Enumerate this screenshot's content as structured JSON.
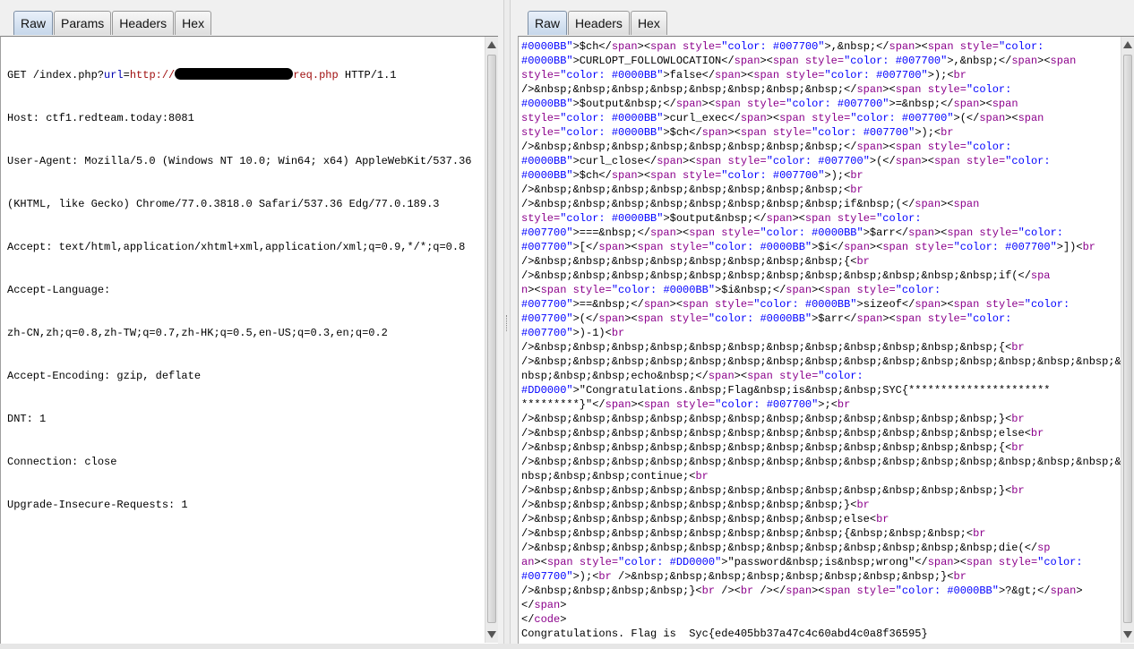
{
  "request_panel": {
    "tabs": [
      "Raw",
      "Params",
      "Headers",
      "Hex"
    ],
    "active_tab": "Raw",
    "request_line": {
      "method_path": "GET /index.php?",
      "param": "url",
      "eq": "=",
      "scheme": "http://",
      "host_suffix": "req.php",
      "version": " HTTP/1.1"
    },
    "headers": [
      "Host: ctf1.redteam.today:8081",
      "User-Agent: Mozilla/5.0 (Windows NT 10.0; Win64; x64) AppleWebKit/537.36",
      "(KHTML, like Gecko) Chrome/77.0.3818.0 Safari/537.36 Edg/77.0.189.3",
      "Accept: text/html,application/xhtml+xml,application/xml;q=0.9,*/*;q=0.8",
      "Accept-Language:",
      "zh-CN,zh;q=0.8,zh-TW;q=0.7,zh-HK;q=0.5,en-US;q=0.3,en;q=0.2",
      "Accept-Encoding: gzip, deflate",
      "DNT: 1",
      "Connection: close",
      "Upgrade-Insecure-Requests: 1"
    ]
  },
  "response_panel": {
    "tabs": [
      "Raw",
      "Headers",
      "Hex"
    ],
    "active_tab": "Raw",
    "colors": {
      "tag": "#8b008b",
      "string": "#0000ff",
      "plain": "#000000",
      "attr": "#8b008b"
    },
    "body_lines": [
      [
        [
          "s",
          "#0000BB\""
        ],
        [
          "p",
          ">$ch</"
        ],
        [
          "t",
          "span"
        ],
        [
          "p",
          "><"
        ],
        [
          "t",
          "span"
        ],
        [
          "a",
          " style="
        ],
        [
          "s",
          "\"color: #007700\""
        ],
        [
          "p",
          ">,&nbsp;</"
        ],
        [
          "t",
          "span"
        ],
        [
          "p",
          "><"
        ],
        [
          "t",
          "span"
        ],
        [
          "a",
          " style="
        ],
        [
          "s",
          "\"color:"
        ]
      ],
      [
        [
          "s",
          "#0000BB\""
        ],
        [
          "p",
          ">CURLOPT_FOLLOWLOCATION</"
        ],
        [
          "t",
          "span"
        ],
        [
          "p",
          "><"
        ],
        [
          "t",
          "span"
        ],
        [
          "a",
          " style="
        ],
        [
          "s",
          "\"color: #007700\""
        ],
        [
          "p",
          ">,&nbsp;</"
        ],
        [
          "t",
          "span"
        ],
        [
          "p",
          "><"
        ],
        [
          "t",
          "span"
        ]
      ],
      [
        [
          "a",
          "style="
        ],
        [
          "s",
          "\"color: #0000BB\""
        ],
        [
          "p",
          ">false</"
        ],
        [
          "t",
          "span"
        ],
        [
          "p",
          "><"
        ],
        [
          "t",
          "span"
        ],
        [
          "a",
          " style="
        ],
        [
          "s",
          "\"color: #007700\""
        ],
        [
          "p",
          ">);<"
        ],
        [
          "t",
          "br"
        ]
      ],
      [
        [
          "p",
          "/>&nbsp;&nbsp;&nbsp;&nbsp;&nbsp;&nbsp;&nbsp;&nbsp;</"
        ],
        [
          "t",
          "span"
        ],
        [
          "p",
          "><"
        ],
        [
          "t",
          "span"
        ],
        [
          "a",
          " style="
        ],
        [
          "s",
          "\"color:"
        ]
      ],
      [
        [
          "s",
          "#0000BB\""
        ],
        [
          "p",
          ">$output&nbsp;</"
        ],
        [
          "t",
          "span"
        ],
        [
          "p",
          "><"
        ],
        [
          "t",
          "span"
        ],
        [
          "a",
          " style="
        ],
        [
          "s",
          "\"color: #007700\""
        ],
        [
          "p",
          ">=&nbsp;</"
        ],
        [
          "t",
          "span"
        ],
        [
          "p",
          "><"
        ],
        [
          "t",
          "span"
        ]
      ],
      [
        [
          "a",
          "style="
        ],
        [
          "s",
          "\"color: #0000BB\""
        ],
        [
          "p",
          ">curl_exec</"
        ],
        [
          "t",
          "span"
        ],
        [
          "p",
          "><"
        ],
        [
          "t",
          "span"
        ],
        [
          "a",
          " style="
        ],
        [
          "s",
          "\"color: #007700\""
        ],
        [
          "p",
          ">(</"
        ],
        [
          "t",
          "span"
        ],
        [
          "p",
          "><"
        ],
        [
          "t",
          "span"
        ]
      ],
      [
        [
          "a",
          "style="
        ],
        [
          "s",
          "\"color: #0000BB\""
        ],
        [
          "p",
          ">$ch</"
        ],
        [
          "t",
          "span"
        ],
        [
          "p",
          "><"
        ],
        [
          "t",
          "span"
        ],
        [
          "a",
          " style="
        ],
        [
          "s",
          "\"color: #007700\""
        ],
        [
          "p",
          ">);<"
        ],
        [
          "t",
          "br"
        ]
      ],
      [
        [
          "p",
          "/>&nbsp;&nbsp;&nbsp;&nbsp;&nbsp;&nbsp;&nbsp;&nbsp;</"
        ],
        [
          "t",
          "span"
        ],
        [
          "p",
          "><"
        ],
        [
          "t",
          "span"
        ],
        [
          "a",
          " style="
        ],
        [
          "s",
          "\"color:"
        ]
      ],
      [
        [
          "s",
          "#0000BB\""
        ],
        [
          "p",
          ">curl_close</"
        ],
        [
          "t",
          "span"
        ],
        [
          "p",
          "><"
        ],
        [
          "t",
          "span"
        ],
        [
          "a",
          " style="
        ],
        [
          "s",
          "\"color: #007700\""
        ],
        [
          "p",
          ">(</"
        ],
        [
          "t",
          "span"
        ],
        [
          "p",
          "><"
        ],
        [
          "t",
          "span"
        ],
        [
          "a",
          " style="
        ],
        [
          "s",
          "\"color:"
        ]
      ],
      [
        [
          "s",
          "#0000BB\""
        ],
        [
          "p",
          ">$ch</"
        ],
        [
          "t",
          "span"
        ],
        [
          "p",
          "><"
        ],
        [
          "t",
          "span"
        ],
        [
          "a",
          " style="
        ],
        [
          "s",
          "\"color: #007700\""
        ],
        [
          "p",
          ">);<"
        ],
        [
          "t",
          "br"
        ]
      ],
      [
        [
          "p",
          "/>&nbsp;&nbsp;&nbsp;&nbsp;&nbsp;&nbsp;&nbsp;&nbsp;<"
        ],
        [
          "t",
          "br"
        ]
      ],
      [
        [
          "p",
          "/>&nbsp;&nbsp;&nbsp;&nbsp;&nbsp;&nbsp;&nbsp;&nbsp;if&nbsp;(</"
        ],
        [
          "t",
          "span"
        ],
        [
          "p",
          "><"
        ],
        [
          "t",
          "span"
        ]
      ],
      [
        [
          "a",
          "style="
        ],
        [
          "s",
          "\"color: #0000BB\""
        ],
        [
          "p",
          ">$output&nbsp;</"
        ],
        [
          "t",
          "span"
        ],
        [
          "p",
          "><"
        ],
        [
          "t",
          "span"
        ],
        [
          "a",
          " style="
        ],
        [
          "s",
          "\"color:"
        ]
      ],
      [
        [
          "s",
          "#007700\""
        ],
        [
          "p",
          ">===&nbsp;</"
        ],
        [
          "t",
          "span"
        ],
        [
          "p",
          "><"
        ],
        [
          "t",
          "span"
        ],
        [
          "a",
          " style="
        ],
        [
          "s",
          "\"color: #0000BB\""
        ],
        [
          "p",
          ">$arr</"
        ],
        [
          "t",
          "span"
        ],
        [
          "p",
          "><"
        ],
        [
          "t",
          "span"
        ],
        [
          "a",
          " style="
        ],
        [
          "s",
          "\"color:"
        ]
      ],
      [
        [
          "s",
          "#007700\""
        ],
        [
          "p",
          ">[</"
        ],
        [
          "t",
          "span"
        ],
        [
          "p",
          "><"
        ],
        [
          "t",
          "span"
        ],
        [
          "a",
          " style="
        ],
        [
          "s",
          "\"color: #0000BB\""
        ],
        [
          "p",
          ">$i</"
        ],
        [
          "t",
          "span"
        ],
        [
          "p",
          "><"
        ],
        [
          "t",
          "span"
        ],
        [
          "a",
          " style="
        ],
        [
          "s",
          "\"color: #007700\""
        ],
        [
          "p",
          ">])<"
        ],
        [
          "t",
          "br"
        ]
      ],
      [
        [
          "p",
          "/>&nbsp;&nbsp;&nbsp;&nbsp;&nbsp;&nbsp;&nbsp;&nbsp;{<"
        ],
        [
          "t",
          "br"
        ]
      ],
      [
        [
          "p",
          "/>&nbsp;&nbsp;&nbsp;&nbsp;&nbsp;&nbsp;&nbsp;&nbsp;&nbsp;&nbsp;&nbsp;&nbsp;if(</"
        ],
        [
          "t",
          "spa"
        ]
      ],
      [
        [
          "t",
          "n"
        ],
        [
          "p",
          "><"
        ],
        [
          "t",
          "span"
        ],
        [
          "a",
          " style="
        ],
        [
          "s",
          "\"color: #0000BB\""
        ],
        [
          "p",
          ">$i&nbsp;</"
        ],
        [
          "t",
          "span"
        ],
        [
          "p",
          "><"
        ],
        [
          "t",
          "span"
        ],
        [
          "a",
          " style="
        ],
        [
          "s",
          "\"color:"
        ]
      ],
      [
        [
          "s",
          "#007700\""
        ],
        [
          "p",
          ">==&nbsp;</"
        ],
        [
          "t",
          "span"
        ],
        [
          "p",
          "><"
        ],
        [
          "t",
          "span"
        ],
        [
          "a",
          " style="
        ],
        [
          "s",
          "\"color: #0000BB\""
        ],
        [
          "p",
          ">sizeof</"
        ],
        [
          "t",
          "span"
        ],
        [
          "p",
          "><"
        ],
        [
          "t",
          "span"
        ],
        [
          "a",
          " style="
        ],
        [
          "s",
          "\"color:"
        ]
      ],
      [
        [
          "s",
          "#007700\""
        ],
        [
          "p",
          ">(</"
        ],
        [
          "t",
          "span"
        ],
        [
          "p",
          "><"
        ],
        [
          "t",
          "span"
        ],
        [
          "a",
          " style="
        ],
        [
          "s",
          "\"color: #0000BB\""
        ],
        [
          "p",
          ">$arr</"
        ],
        [
          "t",
          "span"
        ],
        [
          "p",
          "><"
        ],
        [
          "t",
          "span"
        ],
        [
          "a",
          " style="
        ],
        [
          "s",
          "\"color:"
        ]
      ],
      [
        [
          "s",
          "#007700\""
        ],
        [
          "p",
          ">)-1)<"
        ],
        [
          "t",
          "br"
        ]
      ],
      [
        [
          "p",
          "/>&nbsp;&nbsp;&nbsp;&nbsp;&nbsp;&nbsp;&nbsp;&nbsp;&nbsp;&nbsp;&nbsp;&nbsp;{<"
        ],
        [
          "t",
          "br"
        ]
      ],
      [
        [
          "p",
          "/>&nbsp;&nbsp;&nbsp;&nbsp;&nbsp;&nbsp;&nbsp;&nbsp;&nbsp;&nbsp;&nbsp;&nbsp;&nbsp;&nbsp;&nbsp;&"
        ]
      ],
      [
        [
          "p",
          "nbsp;&nbsp;&nbsp;echo&nbsp;</"
        ],
        [
          "t",
          "span"
        ],
        [
          "p",
          "><"
        ],
        [
          "t",
          "span"
        ],
        [
          "a",
          " style="
        ],
        [
          "s",
          "\"color:"
        ]
      ],
      [
        [
          "s",
          "#DD0000\""
        ],
        [
          "p",
          ">\"Congratulations.&nbsp;Flag&nbsp;is&nbsp;&nbsp;SYC{**********************"
        ]
      ],
      [
        [
          "p",
          "*********}\"</"
        ],
        [
          "t",
          "span"
        ],
        [
          "p",
          "><"
        ],
        [
          "t",
          "span"
        ],
        [
          "a",
          " style="
        ],
        [
          "s",
          "\"color: #007700\""
        ],
        [
          "p",
          ">;<"
        ],
        [
          "t",
          "br"
        ]
      ],
      [
        [
          "p",
          "/>&nbsp;&nbsp;&nbsp;&nbsp;&nbsp;&nbsp;&nbsp;&nbsp;&nbsp;&nbsp;&nbsp;&nbsp;}<"
        ],
        [
          "t",
          "br"
        ]
      ],
      [
        [
          "p",
          "/>&nbsp;&nbsp;&nbsp;&nbsp;&nbsp;&nbsp;&nbsp;&nbsp;&nbsp;&nbsp;&nbsp;&nbsp;else<"
        ],
        [
          "t",
          "br"
        ]
      ],
      [
        [
          "p",
          "/>&nbsp;&nbsp;&nbsp;&nbsp;&nbsp;&nbsp;&nbsp;&nbsp;&nbsp;&nbsp;&nbsp;&nbsp;{<"
        ],
        [
          "t",
          "br"
        ]
      ],
      [
        [
          "p",
          "/>&nbsp;&nbsp;&nbsp;&nbsp;&nbsp;&nbsp;&nbsp;&nbsp;&nbsp;&nbsp;&nbsp;&nbsp;&nbsp;&nbsp;&nbsp;&"
        ]
      ],
      [
        [
          "p",
          "nbsp;&nbsp;&nbsp;continue;<"
        ],
        [
          "t",
          "br"
        ]
      ],
      [
        [
          "p",
          "/>&nbsp;&nbsp;&nbsp;&nbsp;&nbsp;&nbsp;&nbsp;&nbsp;&nbsp;&nbsp;&nbsp;&nbsp;}<"
        ],
        [
          "t",
          "br"
        ]
      ],
      [
        [
          "p",
          "/>&nbsp;&nbsp;&nbsp;&nbsp;&nbsp;&nbsp;&nbsp;&nbsp;}<"
        ],
        [
          "t",
          "br"
        ]
      ],
      [
        [
          "p",
          "/>&nbsp;&nbsp;&nbsp;&nbsp;&nbsp;&nbsp;&nbsp;&nbsp;else<"
        ],
        [
          "t",
          "br"
        ]
      ],
      [
        [
          "p",
          "/>&nbsp;&nbsp;&nbsp;&nbsp;&nbsp;&nbsp;&nbsp;&nbsp;{&nbsp;&nbsp;&nbsp;<"
        ],
        [
          "t",
          "br"
        ]
      ],
      [
        [
          "p",
          "/>&nbsp;&nbsp;&nbsp;&nbsp;&nbsp;&nbsp;&nbsp;&nbsp;&nbsp;&nbsp;&nbsp;&nbsp;die(</"
        ],
        [
          "t",
          "sp"
        ]
      ],
      [
        [
          "t",
          "an"
        ],
        [
          "p",
          "><"
        ],
        [
          "t",
          "span"
        ],
        [
          "a",
          " style="
        ],
        [
          "s",
          "\"color: #DD0000\""
        ],
        [
          "p",
          ">\"password&nbsp;is&nbsp;wrong\"</"
        ],
        [
          "t",
          "span"
        ],
        [
          "p",
          "><"
        ],
        [
          "t",
          "span"
        ],
        [
          "a",
          " style="
        ],
        [
          "s",
          "\"color:"
        ]
      ],
      [
        [
          "s",
          "#007700\""
        ],
        [
          "p",
          ">);<"
        ],
        [
          "t",
          "br"
        ],
        [
          "p",
          " />&nbsp;&nbsp;&nbsp;&nbsp;&nbsp;&nbsp;&nbsp;&nbsp;}<"
        ],
        [
          "t",
          "br"
        ]
      ],
      [
        [
          "p",
          "/>&nbsp;&nbsp;&nbsp;&nbsp;}<"
        ],
        [
          "t",
          "br"
        ],
        [
          "p",
          " /><"
        ],
        [
          "t",
          "br"
        ],
        [
          "p",
          " /></"
        ],
        [
          "t",
          "span"
        ],
        [
          "p",
          "><"
        ],
        [
          "t",
          "span"
        ],
        [
          "a",
          " style="
        ],
        [
          "s",
          "\"color: #0000BB\""
        ],
        [
          "p",
          ">?&gt;</"
        ],
        [
          "t",
          "span"
        ],
        [
          "p",
          ">"
        ]
      ],
      [
        [
          "p",
          "</"
        ],
        [
          "t",
          "span"
        ],
        [
          "p",
          ">"
        ]
      ],
      [
        [
          "p",
          "</"
        ],
        [
          "t",
          "code"
        ],
        [
          "p",
          ">"
        ]
      ],
      [
        [
          "p",
          "Congratulations. Flag is  Syc{ede405bb37a47c4c60abd4c0a8f36595}"
        ]
      ]
    ]
  }
}
